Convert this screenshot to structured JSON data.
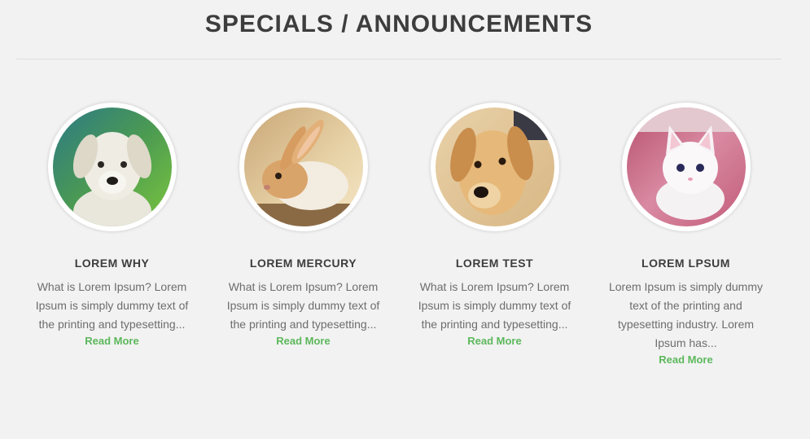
{
  "header": {
    "title": "SPECIALS / ANNOUNCEMENTS"
  },
  "cards": [
    {
      "title": "LOREM WHY",
      "description": "What is Lorem Ipsum? Lorem Ipsum is simply dummy text of the printing and typesetting...",
      "link": "Read More",
      "image": "puppy-photo"
    },
    {
      "title": "LOREM MERCURY",
      "description": "What is Lorem Ipsum? Lorem Ipsum is simply dummy text of the printing and typesetting...",
      "link": "Read More",
      "image": "bunny-photo"
    },
    {
      "title": "LOREM TEST",
      "description": "What is Lorem Ipsum? Lorem Ipsum is simply dummy text of the printing and typesetting...",
      "link": "Read More",
      "image": "golden-puppy-photo"
    },
    {
      "title": "LOREM LPSUM",
      "description": "Lorem Ipsum is simply dummy text of the printing and typesetting industry. Lorem Ipsum has...",
      "link": "Read More",
      "image": "kitten-photo"
    }
  ],
  "colors": {
    "background": "#f2f2f2",
    "heading": "#3d3d3d",
    "body_text": "#6d6d6d",
    "link": "#5cb85c"
  }
}
